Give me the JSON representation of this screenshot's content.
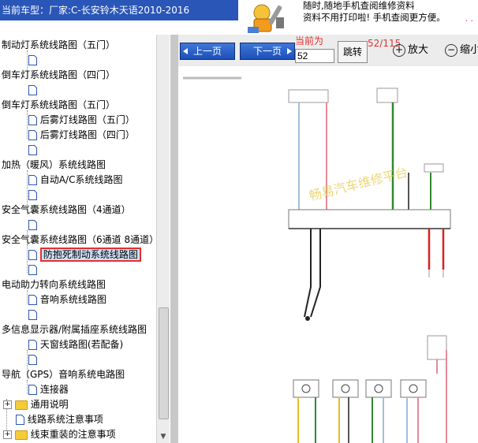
{
  "header": {
    "title": "当前车型：厂家:C-长安铃木天语2010-2016",
    "notice_line1": "随时,随地手机查阅维修资料",
    "notice_line2": "资料不用打印啦! 手机查阅更方便。",
    "notice_dots": ". ."
  },
  "toolbar": {
    "prev_label": "上一页",
    "next_label": "下一页",
    "current_label": "当前为",
    "page_value": "52",
    "jump_label": "跳转",
    "page_count": "52/115",
    "zoom_in_label": "放大",
    "zoom_out_label": "缩小"
  },
  "tree": {
    "items": [
      {
        "label": "制动灯系统线路图（五门）"
      },
      {
        "label": ""
      },
      {
        "label": "倒车灯系统线路图（四门）"
      },
      {
        "label": ""
      },
      {
        "label": "倒车灯系统线路图（五门）"
      },
      {
        "label": "后雾灯线路图（五门）"
      },
      {
        "label": "后雾灯线路图（四门）"
      },
      {
        "label": ""
      },
      {
        "label": "加热（暖风）系统线路图"
      },
      {
        "label": "自动A/C系统线路图"
      },
      {
        "label": ""
      },
      {
        "label": "安全气囊系统线路图（4通道）"
      },
      {
        "label": ""
      },
      {
        "label": "安全气囊系统线路图（6通道 8通道）"
      },
      {
        "label": "防抱死制动系统线路图"
      },
      {
        "label": ""
      },
      {
        "label": "电动助力转向系统线路图"
      },
      {
        "label": "音响系统线路图"
      },
      {
        "label": ""
      },
      {
        "label": "多信息显示器/附属插座系统线路图"
      },
      {
        "label": "天窗线路图(若配备)"
      },
      {
        "label": ""
      },
      {
        "label": "导航（GPS）音响系统电路图"
      },
      {
        "label": "连接器"
      },
      {
        "label": "通用说明"
      },
      {
        "label": "线路系统注意事项"
      },
      {
        "label": "线束重装的注意事项"
      }
    ]
  },
  "diagram": {
    "watermark": "畅易汽车维修平台"
  },
  "colors": {
    "header_bg": "#2a56b7",
    "nav_button": "#1c4fb8",
    "accent_red": "#e03030",
    "selection_bg": "#cfe0f8"
  }
}
